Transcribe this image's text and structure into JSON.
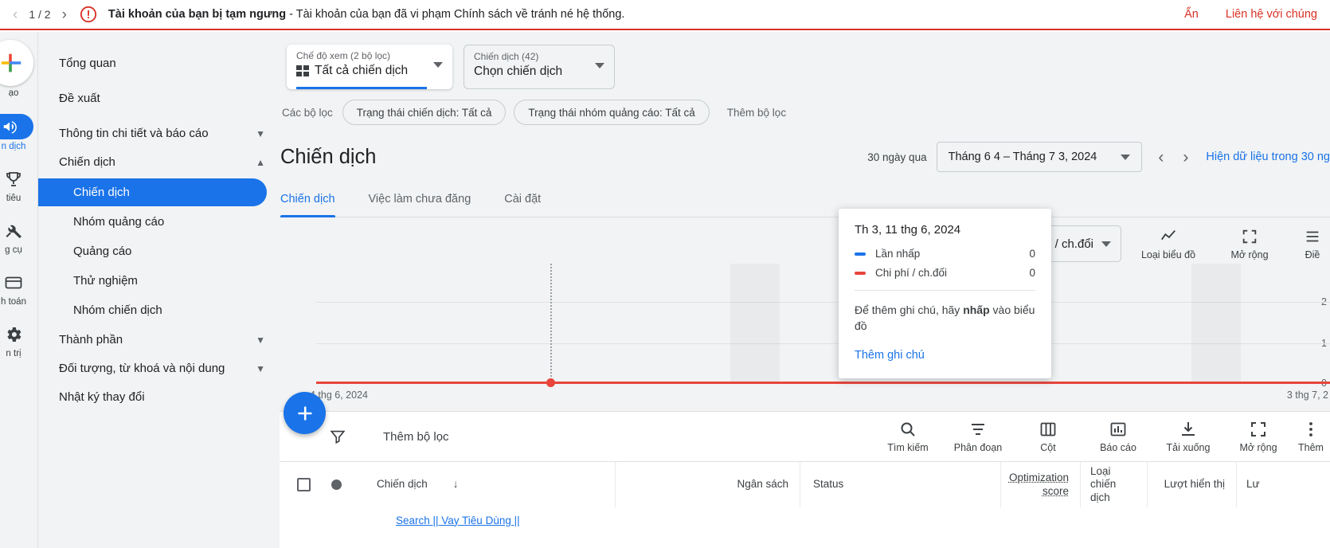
{
  "banner": {
    "page_indicator": "1 / 2",
    "prev_icon": "chevron-left-icon",
    "next_icon": "chevron-right-icon",
    "warning_icon": "error-circle-icon",
    "title": "Tài khoản của bạn bị tạm ngưng",
    "body": " - Tài khoản của bạn đã vi phạm Chính sách về tránh né hệ thống.",
    "hide_label": "Ẩn",
    "contact_label": "Liên hệ với chúng",
    "accent_color": "#d93025"
  },
  "rail": {
    "items": [
      {
        "label": "ạo",
        "icon": "google-plus-create-icon",
        "style": "create"
      },
      {
        "label": "n dịch",
        "icon": "campaigns-icon",
        "style": "pill",
        "active": true
      },
      {
        "label": "tiêu",
        "icon": "goals-trophy-icon",
        "style": "plain"
      },
      {
        "label": "g cụ",
        "icon": "tools-wrench-icon",
        "style": "plain"
      },
      {
        "label": "h toán",
        "icon": "billing-card-icon",
        "style": "plain"
      },
      {
        "label": "n trị",
        "icon": "admin-gear-icon",
        "style": "plain"
      }
    ]
  },
  "sidebar": {
    "items": [
      {
        "label": "Tổng quan",
        "type": "row"
      },
      {
        "label": "Đề xuất",
        "type": "row"
      },
      {
        "label": "Thông tin chi tiết và báo cáo",
        "type": "row",
        "expand": "chevron-down-icon"
      },
      {
        "label": "Chiến dịch",
        "type": "row",
        "expand": "chevron-up-icon"
      },
      {
        "label": "Chiến dịch",
        "type": "sub",
        "selected": true
      },
      {
        "label": "Nhóm quảng cáo",
        "type": "sub"
      },
      {
        "label": "Quảng cáo",
        "type": "sub"
      },
      {
        "label": "Thử nghiệm",
        "type": "sub"
      },
      {
        "label": "Nhóm chiến dịch",
        "type": "sub"
      },
      {
        "label": "Thành phần",
        "type": "row",
        "expand": "chevron-down-icon"
      },
      {
        "label": "Đối tượng, từ khoá và nội dung",
        "type": "row",
        "expand": "chevron-down-icon"
      },
      {
        "label": "Nhật ký thay đổi",
        "type": "row"
      }
    ]
  },
  "toolbar": {
    "view_caption": "Chế độ xem (2 bộ lọc)",
    "view_value": "Tất cả chiến dịch",
    "campaign_caption": "Chiến dịch (42)",
    "campaign_value": "Chọn chiến dịch",
    "filters_label": "Các bộ lọc",
    "chips": [
      "Trạng thái chiến dịch: Tất cả",
      "Trạng thái nhóm quảng cáo: Tất cả"
    ],
    "add_filter": "Thêm bộ lọc"
  },
  "page": {
    "title": "Chiến dịch",
    "range_note": "30 ngày qua",
    "date_range": "Tháng 6 4 – Tháng 7 3, 2024",
    "show_data_link": "Hiện dữ liệu trong 30 ng",
    "tabs": [
      {
        "label": "Chiến dịch",
        "active": true
      },
      {
        "label": "Việc làm chưa đăng",
        "active": false
      },
      {
        "label": "Cài đặt",
        "active": false
      }
    ]
  },
  "chart_controls": {
    "metric_1": {
      "label": "Lần nhấp",
      "color": "#1a73e8"
    },
    "metric_2": {
      "label": "Chi phí / ch.đổi",
      "color": "#e8453c"
    },
    "buttons": [
      {
        "label": "Loại biểu đồ",
        "icon": "line-chart-icon"
      },
      {
        "label": "Mở rộng",
        "icon": "expand-icon"
      },
      {
        "label": "Điề",
        "icon": "adjust-icon"
      }
    ]
  },
  "chart_data": {
    "type": "line",
    "title": "",
    "xlabel": "",
    "ylabel": "",
    "ylim": [
      0,
      2
    ],
    "yticks": [
      0,
      1,
      2
    ],
    "x_start_label": "4 thg 6, 2024",
    "x_end_label": "3 thg 7, 2",
    "grid": true,
    "legend_position": "top-right",
    "series": [
      {
        "name": "Lần nhấp",
        "color": "#1a73e8",
        "values": [
          0,
          0,
          0,
          0,
          0,
          0,
          0,
          0,
          0,
          0,
          0,
          0,
          0,
          0,
          0,
          0,
          0,
          0,
          0,
          0,
          0,
          0,
          0,
          0,
          0,
          0,
          0,
          0,
          0,
          0
        ]
      },
      {
        "name": "Chi phí / ch.đổi",
        "color": "#e8453c",
        "values": [
          0,
          0,
          0,
          0,
          0,
          0,
          0,
          0,
          0,
          0,
          0,
          0,
          0,
          0,
          0,
          0,
          0,
          0,
          0,
          0,
          0,
          0,
          0,
          0,
          0,
          0,
          0,
          0,
          0,
          0
        ]
      }
    ],
    "hover_point": {
      "date": "Th 3, 11 thg 6, 2024",
      "index": 7
    }
  },
  "tooltip": {
    "date": "Th 3, 11 thg 6, 2024",
    "rows": [
      {
        "label": "Lần nhấp",
        "value": "0",
        "color": "#1a73e8"
      },
      {
        "label": "Chi phí / ch.đối",
        "value": "0",
        "color": "#e8453c"
      }
    ],
    "hint_a": "Để thêm ghi chú, hãy ",
    "hint_b": "nhấp",
    "hint_c": " vào biểu đồ",
    "link": "Thêm ghi chú"
  },
  "fab": {
    "icon": "plus-icon",
    "label": ""
  },
  "table": {
    "add_filter": "Thêm bộ lọc",
    "filter_icon": "funnel-icon",
    "tools": [
      {
        "label": "Tìm kiếm",
        "icon": "search-icon"
      },
      {
        "label": "Phân đoạn",
        "icon": "segment-icon"
      },
      {
        "label": "Cột",
        "icon": "columns-icon"
      },
      {
        "label": "Báo cáo",
        "icon": "report-icon"
      },
      {
        "label": "Tải xuống",
        "icon": "download-icon"
      },
      {
        "label": "Mở rộng",
        "icon": "expand-icon"
      },
      {
        "label": "Thêm",
        "icon": "more-vertical-icon"
      }
    ],
    "columns": [
      {
        "label": "Chiến dịch",
        "sort": "↓"
      },
      {
        "label": "Ngân sách"
      },
      {
        "label": "Status"
      },
      {
        "label": "Optimization score"
      },
      {
        "label": "Loại chiến dịch"
      },
      {
        "label": "Lượt hiển thị"
      },
      {
        "label": "Lư"
      }
    ],
    "rows": [
      {
        "campaign": "Search || Vay Tiêu Dùng ||"
      }
    ]
  }
}
